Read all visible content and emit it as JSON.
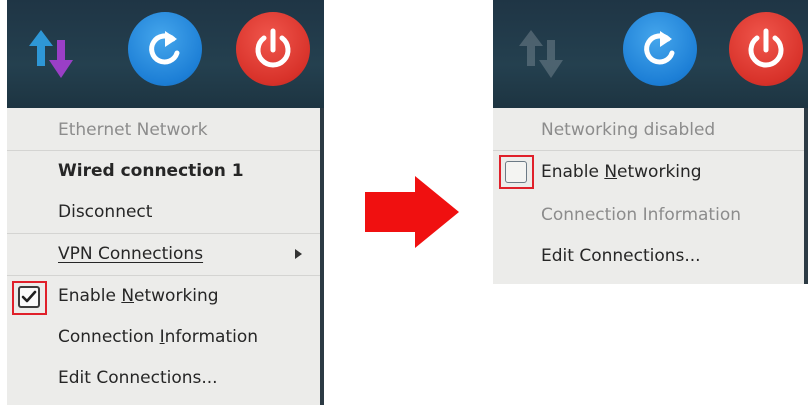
{
  "before": {
    "menu": {
      "items": [
        {
          "label": "Ethernet Network",
          "state": "disabled"
        },
        {
          "label": "Wired connection 1",
          "state": "bold"
        },
        {
          "label": "Disconnect",
          "state": "normal"
        },
        {
          "label": "VPN Connections",
          "state": "normal",
          "mnemonic": "V",
          "submenu": true
        },
        {
          "label": "Enable Networking",
          "state": "normal",
          "mnemonic": "N",
          "checkbox": "checked"
        },
        {
          "label": "Connection Information",
          "state": "normal",
          "mnemonic": "I"
        },
        {
          "label": "Edit Connections...",
          "state": "normal"
        }
      ]
    }
  },
  "after": {
    "menu": {
      "items": [
        {
          "label": "Networking disabled",
          "state": "disabled"
        },
        {
          "label": "Enable Networking",
          "state": "normal",
          "mnemonic": "N",
          "checkbox": "unchecked"
        },
        {
          "label": "Connection Information",
          "state": "disabled"
        },
        {
          "label": "Edit Connections...",
          "state": "normal"
        }
      ]
    }
  },
  "icons": {
    "network": "network-transfer-icon",
    "refresh": "refresh-icon",
    "power": "power-icon",
    "arrow": "right-arrow-icon",
    "checkmark": "checkmark-icon",
    "submenu": "submenu-arrow-icon"
  },
  "colors": {
    "highlight_box": "#e0202a",
    "transition_arrow": "#f01010",
    "refresh_button": "#1d7fd6",
    "power_button": "#d8322a",
    "menu_background": "#ececea",
    "panel_background": "#24404f"
  }
}
